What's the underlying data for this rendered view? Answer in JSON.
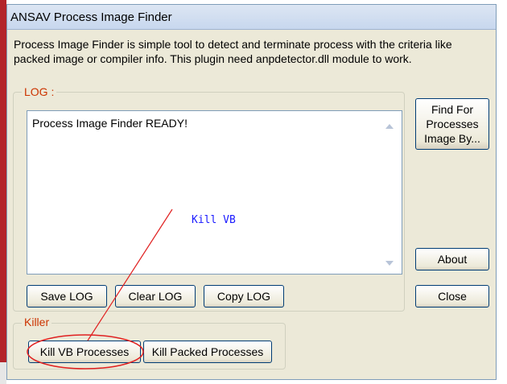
{
  "window": {
    "title": "ANSAV Process Image Finder",
    "description": "Process Image Finder is simple tool to detect and terminate process with the criteria like packed image or compiler info. This plugin need anpdetector.dll module to work."
  },
  "log": {
    "legend": "LOG :",
    "content": "Process Image Finder READY!",
    "buttons": {
      "save": "Save LOG",
      "clear": "Clear LOG",
      "copy": "Copy LOG"
    }
  },
  "side_buttons": {
    "find_line1": "Find For",
    "find_line2": "Processes",
    "find_line3": "Image By...",
    "about": "About",
    "close": "Close"
  },
  "killer": {
    "legend": "Killer",
    "kill_vb": "Kill VB Processes",
    "kill_packed": "Kill Packed Processes"
  },
  "annotation": {
    "text": "Kill VB",
    "color": "#e02020",
    "text_color": "#1a1aff"
  },
  "colors": {
    "window_bg": "#ece9d8",
    "group_legend": "#cc3300",
    "button_border": "#003c74"
  }
}
